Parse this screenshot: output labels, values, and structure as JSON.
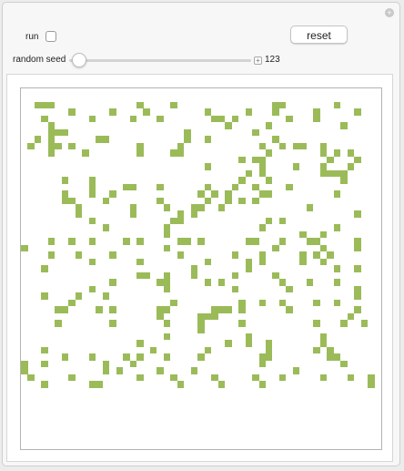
{
  "controls": {
    "run_label": "run",
    "run_checked": false,
    "reset_label": "reset",
    "seed_label": "random seed",
    "seed_value": "123",
    "seed_slider_fraction": 0.02
  },
  "colors": {
    "live_cell": "#9bbb59"
  },
  "board": {
    "size": 53,
    "live_cells": [
      [
        2,
        2
      ],
      [
        3,
        2
      ],
      [
        4,
        2
      ],
      [
        17,
        2
      ],
      [
        22,
        2
      ],
      [
        37,
        2
      ],
      [
        38,
        2
      ],
      [
        46,
        2
      ],
      [
        7,
        3
      ],
      [
        13,
        3
      ],
      [
        18,
        3
      ],
      [
        27,
        3
      ],
      [
        33,
        3
      ],
      [
        37,
        3
      ],
      [
        43,
        3
      ],
      [
        49,
        3
      ],
      [
        3,
        4
      ],
      [
        10,
        4
      ],
      [
        16,
        4
      ],
      [
        20,
        4
      ],
      [
        28,
        4
      ],
      [
        29,
        4
      ],
      [
        31,
        4
      ],
      [
        39,
        4
      ],
      [
        43,
        4
      ],
      [
        4,
        5
      ],
      [
        30,
        5
      ],
      [
        36,
        5
      ],
      [
        47,
        5
      ],
      [
        4,
        6
      ],
      [
        5,
        6
      ],
      [
        6,
        6
      ],
      [
        24,
        6
      ],
      [
        34,
        6
      ],
      [
        2,
        7
      ],
      [
        4,
        7
      ],
      [
        11,
        7
      ],
      [
        12,
        7
      ],
      [
        24,
        7
      ],
      [
        27,
        7
      ],
      [
        37,
        7
      ],
      [
        1,
        8
      ],
      [
        4,
        8
      ],
      [
        5,
        8
      ],
      [
        7,
        8
      ],
      [
        17,
        8
      ],
      [
        23,
        8
      ],
      [
        35,
        8
      ],
      [
        38,
        8
      ],
      [
        40,
        8
      ],
      [
        41,
        8
      ],
      [
        44,
        8
      ],
      [
        4,
        9
      ],
      [
        9,
        9
      ],
      [
        17,
        9
      ],
      [
        22,
        9
      ],
      [
        23,
        9
      ],
      [
        36,
        9
      ],
      [
        44,
        9
      ],
      [
        46,
        9
      ],
      [
        48,
        9
      ],
      [
        32,
        10
      ],
      [
        34,
        10
      ],
      [
        35,
        10
      ],
      [
        45,
        10
      ],
      [
        49,
        10
      ],
      [
        27,
        11
      ],
      [
        35,
        11
      ],
      [
        40,
        11
      ],
      [
        44,
        11
      ],
      [
        48,
        11
      ],
      [
        33,
        12
      ],
      [
        35,
        12
      ],
      [
        44,
        12
      ],
      [
        45,
        12
      ],
      [
        46,
        12
      ],
      [
        47,
        12
      ],
      [
        6,
        13
      ],
      [
        10,
        13
      ],
      [
        32,
        13
      ],
      [
        36,
        13
      ],
      [
        47,
        13
      ],
      [
        10,
        14
      ],
      [
        15,
        14
      ],
      [
        16,
        14
      ],
      [
        20,
        14
      ],
      [
        27,
        14
      ],
      [
        31,
        14
      ],
      [
        34,
        14
      ],
      [
        39,
        14
      ],
      [
        6,
        15
      ],
      [
        10,
        15
      ],
      [
        13,
        15
      ],
      [
        26,
        15
      ],
      [
        28,
        15
      ],
      [
        30,
        15
      ],
      [
        35,
        15
      ],
      [
        36,
        15
      ],
      [
        46,
        15
      ],
      [
        6,
        16
      ],
      [
        7,
        16
      ],
      [
        12,
        16
      ],
      [
        20,
        16
      ],
      [
        27,
        16
      ],
      [
        30,
        16
      ],
      [
        32,
        16
      ],
      [
        34,
        16
      ],
      [
        8,
        17
      ],
      [
        16,
        17
      ],
      [
        21,
        17
      ],
      [
        25,
        17
      ],
      [
        26,
        17
      ],
      [
        29,
        17
      ],
      [
        42,
        17
      ],
      [
        8,
        18
      ],
      [
        16,
        18
      ],
      [
        23,
        18
      ],
      [
        25,
        18
      ],
      [
        49,
        18
      ],
      [
        10,
        19
      ],
      [
        22,
        19
      ],
      [
        23,
        19
      ],
      [
        36,
        19
      ],
      [
        38,
        19
      ],
      [
        12,
        20
      ],
      [
        21,
        20
      ],
      [
        35,
        20
      ],
      [
        46,
        20
      ],
      [
        21,
        21
      ],
      [
        41,
        21
      ],
      [
        44,
        21
      ],
      [
        4,
        22
      ],
      [
        7,
        22
      ],
      [
        10,
        22
      ],
      [
        15,
        22
      ],
      [
        17,
        22
      ],
      [
        23,
        22
      ],
      [
        24,
        22
      ],
      [
        26,
        22
      ],
      [
        33,
        22
      ],
      [
        34,
        22
      ],
      [
        38,
        22
      ],
      [
        42,
        22
      ],
      [
        43,
        22
      ],
      [
        49,
        22
      ],
      [
        0,
        23
      ],
      [
        21,
        23
      ],
      [
        37,
        23
      ],
      [
        44,
        23
      ],
      [
        49,
        23
      ],
      [
        4,
        24
      ],
      [
        8,
        24
      ],
      [
        13,
        24
      ],
      [
        23,
        24
      ],
      [
        31,
        24
      ],
      [
        35,
        24
      ],
      [
        41,
        24
      ],
      [
        43,
        24
      ],
      [
        45,
        24
      ],
      [
        10,
        25
      ],
      [
        17,
        25
      ],
      [
        27,
        25
      ],
      [
        33,
        25
      ],
      [
        35,
        25
      ],
      [
        41,
        25
      ],
      [
        44,
        25
      ],
      [
        3,
        26
      ],
      [
        25,
        26
      ],
      [
        33,
        26
      ],
      [
        46,
        26
      ],
      [
        49,
        26
      ],
      [
        17,
        27
      ],
      [
        18,
        27
      ],
      [
        21,
        27
      ],
      [
        25,
        27
      ],
      [
        31,
        27
      ],
      [
        37,
        27
      ],
      [
        13,
        28
      ],
      [
        20,
        28
      ],
      [
        21,
        28
      ],
      [
        27,
        28
      ],
      [
        29,
        28
      ],
      [
        38,
        28
      ],
      [
        42,
        28
      ],
      [
        46,
        28
      ],
      [
        10,
        29
      ],
      [
        21,
        29
      ],
      [
        31,
        29
      ],
      [
        39,
        29
      ],
      [
        49,
        29
      ],
      [
        3,
        30
      ],
      [
        8,
        30
      ],
      [
        12,
        30
      ],
      [
        49,
        30
      ],
      [
        7,
        31
      ],
      [
        22,
        31
      ],
      [
        32,
        31
      ],
      [
        35,
        31
      ],
      [
        38,
        31
      ],
      [
        43,
        31
      ],
      [
        46,
        31
      ],
      [
        5,
        32
      ],
      [
        6,
        32
      ],
      [
        11,
        32
      ],
      [
        13,
        32
      ],
      [
        20,
        32
      ],
      [
        21,
        32
      ],
      [
        28,
        32
      ],
      [
        29,
        32
      ],
      [
        30,
        32
      ],
      [
        32,
        32
      ],
      [
        39,
        32
      ],
      [
        49,
        32
      ],
      [
        20,
        33
      ],
      [
        26,
        33
      ],
      [
        27,
        33
      ],
      [
        28,
        33
      ],
      [
        48,
        33
      ],
      [
        5,
        34
      ],
      [
        13,
        34
      ],
      [
        21,
        34
      ],
      [
        26,
        34
      ],
      [
        32,
        34
      ],
      [
        43,
        34
      ],
      [
        47,
        34
      ],
      [
        50,
        34
      ],
      [
        26,
        35
      ],
      [
        21,
        36
      ],
      [
        33,
        36
      ],
      [
        44,
        36
      ],
      [
        17,
        37
      ],
      [
        30,
        37
      ],
      [
        33,
        37
      ],
      [
        36,
        37
      ],
      [
        44,
        37
      ],
      [
        3,
        38
      ],
      [
        19,
        38
      ],
      [
        27,
        38
      ],
      [
        36,
        38
      ],
      [
        43,
        38
      ],
      [
        45,
        38
      ],
      [
        6,
        39
      ],
      [
        10,
        39
      ],
      [
        15,
        39
      ],
      [
        17,
        39
      ],
      [
        21,
        39
      ],
      [
        26,
        39
      ],
      [
        35,
        39
      ],
      [
        36,
        39
      ],
      [
        45,
        39
      ],
      [
        46,
        39
      ],
      [
        0,
        40
      ],
      [
        3,
        40
      ],
      [
        12,
        40
      ],
      [
        16,
        40
      ],
      [
        35,
        40
      ],
      [
        47,
        40
      ],
      [
        0,
        41
      ],
      [
        12,
        41
      ],
      [
        14,
        41
      ],
      [
        20,
        41
      ],
      [
        25,
        41
      ],
      [
        40,
        41
      ],
      [
        1,
        42
      ],
      [
        7,
        42
      ],
      [
        17,
        42
      ],
      [
        22,
        42
      ],
      [
        28,
        42
      ],
      [
        34,
        42
      ],
      [
        38,
        42
      ],
      [
        44,
        42
      ],
      [
        48,
        42
      ],
      [
        51,
        42
      ],
      [
        3,
        43
      ],
      [
        10,
        43
      ],
      [
        11,
        43
      ],
      [
        23,
        43
      ],
      [
        29,
        43
      ],
      [
        35,
        43
      ],
      [
        51,
        43
      ]
    ]
  }
}
